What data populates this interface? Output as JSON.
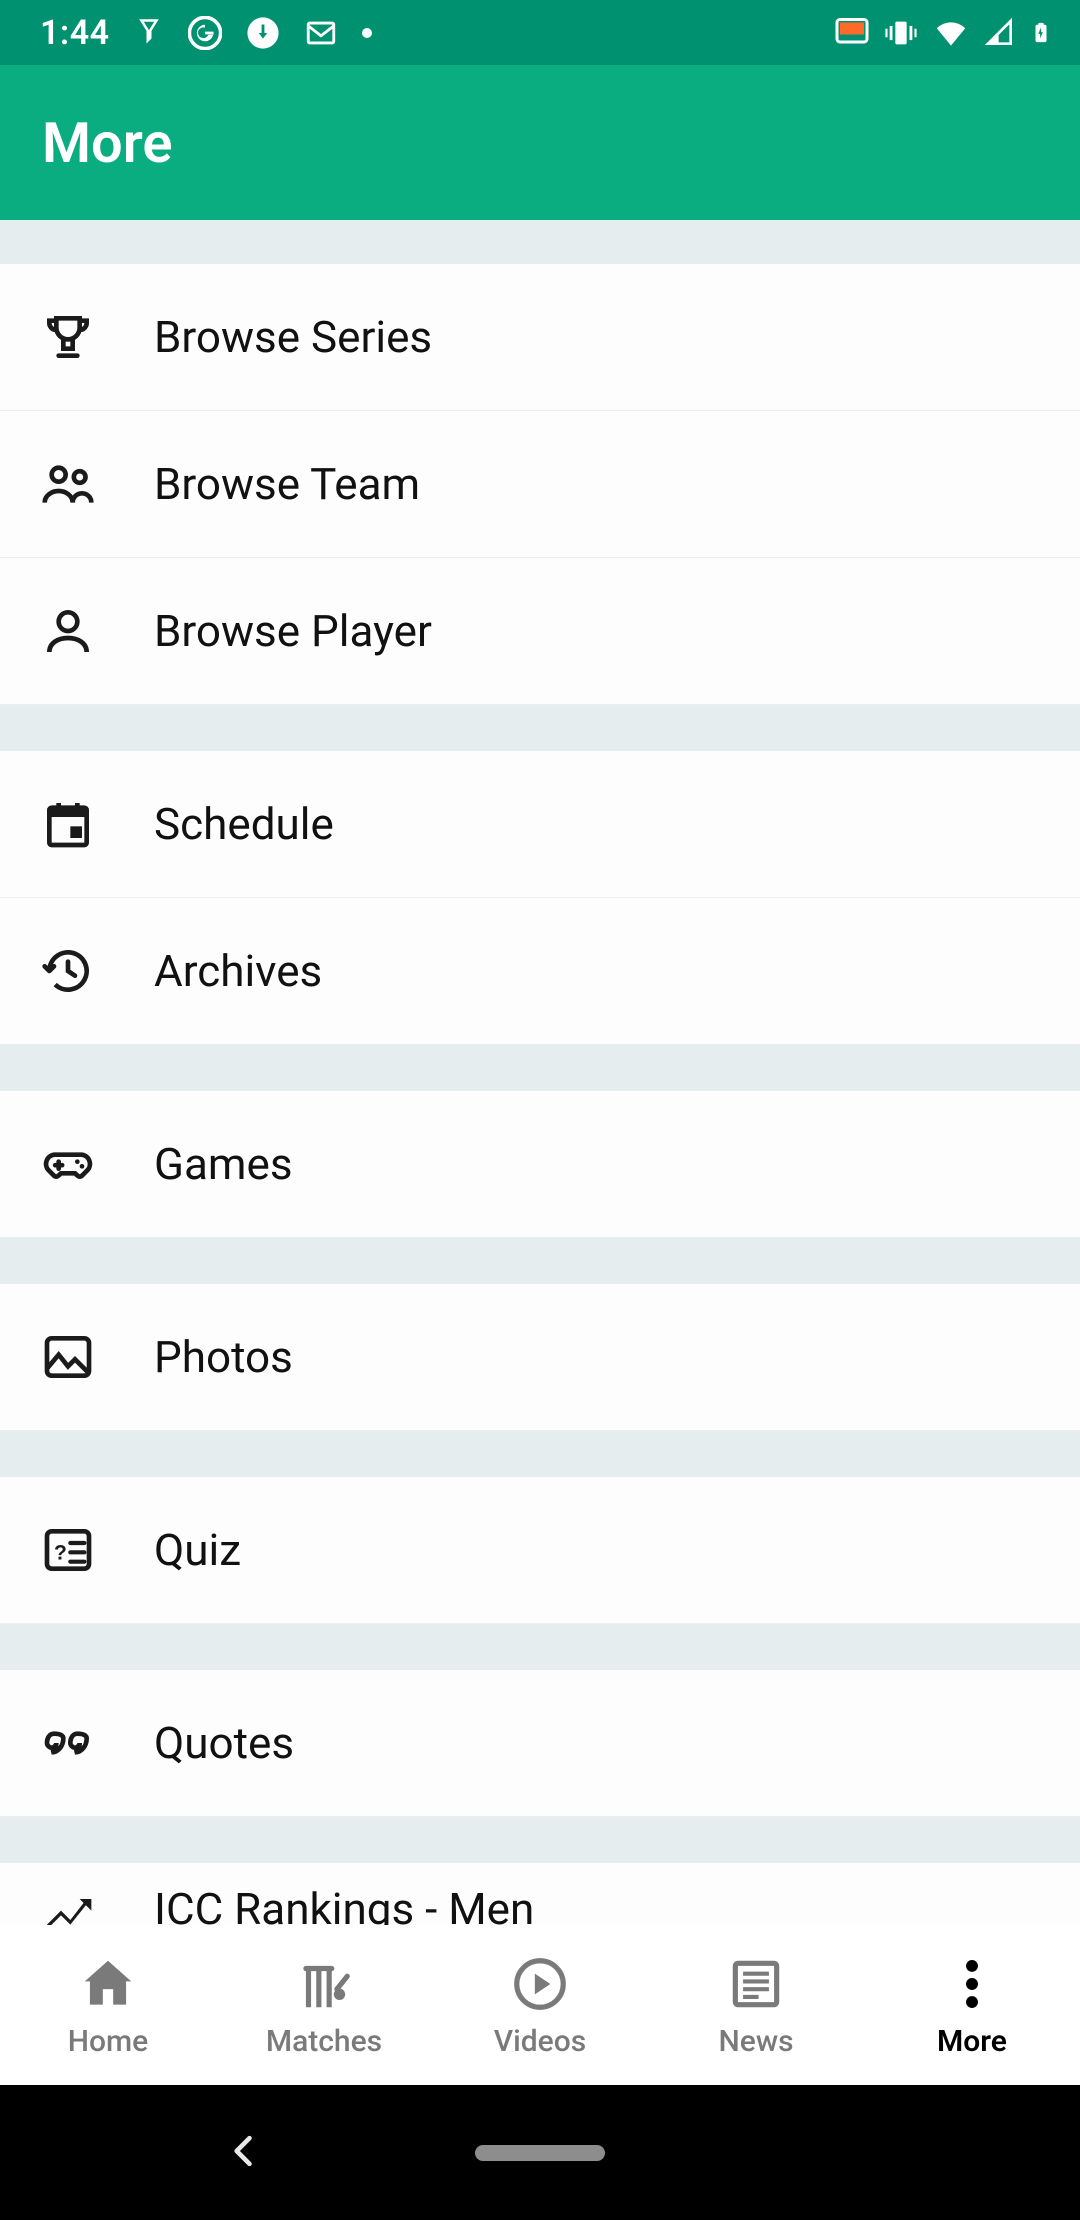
{
  "status": {
    "clock": "1:44"
  },
  "app": {
    "title": "More"
  },
  "menu": [
    {
      "id": "browse-series",
      "label": "Browse Series"
    },
    {
      "id": "browse-team",
      "label": "Browse Team"
    },
    {
      "id": "browse-player",
      "label": "Browse Player"
    },
    {
      "id": "schedule",
      "label": "Schedule"
    },
    {
      "id": "archives",
      "label": "Archives"
    },
    {
      "id": "games",
      "label": "Games"
    },
    {
      "id": "photos",
      "label": "Photos"
    },
    {
      "id": "quiz",
      "label": "Quiz"
    },
    {
      "id": "quotes",
      "label": "Quotes"
    },
    {
      "id": "icc-rankings",
      "label": "ICC Rankings - Men"
    }
  ],
  "tabs": {
    "home": {
      "label": "Home"
    },
    "matches": {
      "label": "Matches"
    },
    "videos": {
      "label": "Videos"
    },
    "news": {
      "label": "News"
    },
    "more": {
      "label": "More"
    }
  }
}
